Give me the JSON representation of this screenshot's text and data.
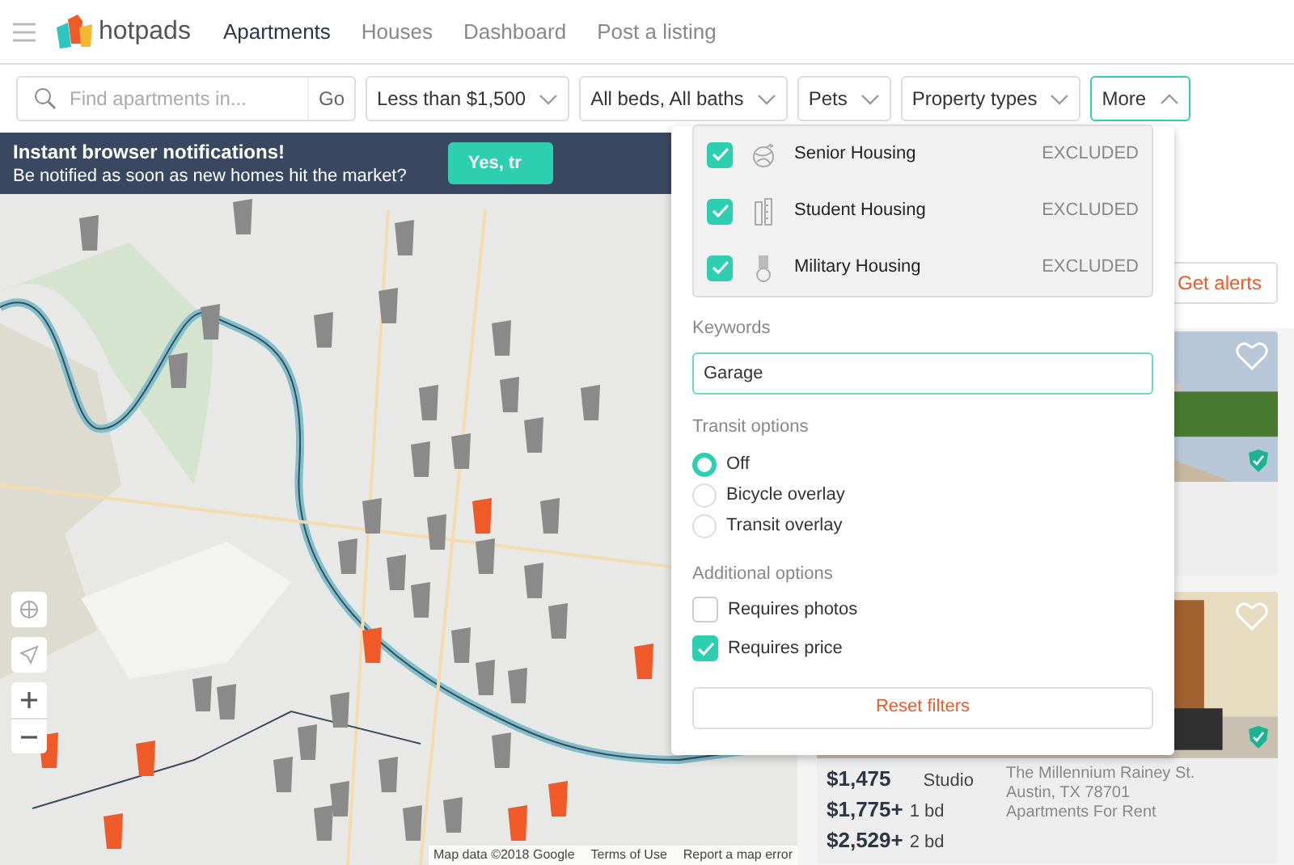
{
  "header": {
    "logo": "hotpads",
    "nav": [
      {
        "label": "Apartments",
        "selected": true
      },
      {
        "label": "Houses",
        "selected": false
      },
      {
        "label": "Dashboard",
        "selected": false
      },
      {
        "label": "Post a listing",
        "selected": false
      }
    ]
  },
  "filters": {
    "search": {
      "placeholder": "Find apartments in...",
      "button": "Go"
    },
    "dropdowns": [
      {
        "label": "Less than $1,500",
        "open": false
      },
      {
        "label": "All beds, All baths",
        "open": false
      },
      {
        "label": "Pets",
        "open": false
      },
      {
        "label": "Property types",
        "open": false
      },
      {
        "label": "More",
        "open": true
      }
    ]
  },
  "banner": {
    "title": "Instant browser notifications!",
    "text": "Be notified as soon as new homes hit the market?",
    "button": "Yes, tr"
  },
  "map": {
    "attribution": [
      "Map data ©2018 Google",
      "Terms of Use",
      "Report a map error"
    ]
  },
  "listings": {
    "alerts_button": "Get alerts",
    "cards": [
      {
        "kind": "skyline",
        "favorited": false,
        "verified": true
      },
      {
        "kind": "interior",
        "favorited": false,
        "verified": true,
        "prices": [
          {
            "price": "$1,475",
            "beds": "Studio"
          },
          {
            "price": "$1,775+",
            "beds": "1 bd"
          },
          {
            "price": "$2,529+",
            "beds": "2 bd"
          }
        ],
        "address": [
          "The Millennium Rainey St.",
          "Austin, TX 78701",
          "Apartments For Rent"
        ]
      }
    ]
  },
  "more_menu": {
    "property_types": [
      {
        "kind": "yarn",
        "label": "Senior Housing",
        "checked": true,
        "status": "EXCLUDED"
      },
      {
        "kind": "ruler",
        "label": "Student Housing",
        "checked": true,
        "status": "EXCLUDED"
      },
      {
        "kind": "medal",
        "label": "Military Housing",
        "checked": true,
        "status": "EXCLUDED"
      }
    ],
    "keywords": {
      "label": "Keywords",
      "value": "Garage"
    },
    "transit": {
      "label": "Transit options",
      "options": [
        {
          "label": "Off",
          "selected": true
        },
        {
          "label": "Bicycle overlay",
          "selected": false
        },
        {
          "label": "Transit overlay",
          "selected": false
        }
      ]
    },
    "additional": {
      "label": "Additional options",
      "options": [
        {
          "label": "Requires photos",
          "checked": false
        },
        {
          "label": "Requires price",
          "checked": true
        }
      ]
    },
    "reset": "Reset filters"
  }
}
